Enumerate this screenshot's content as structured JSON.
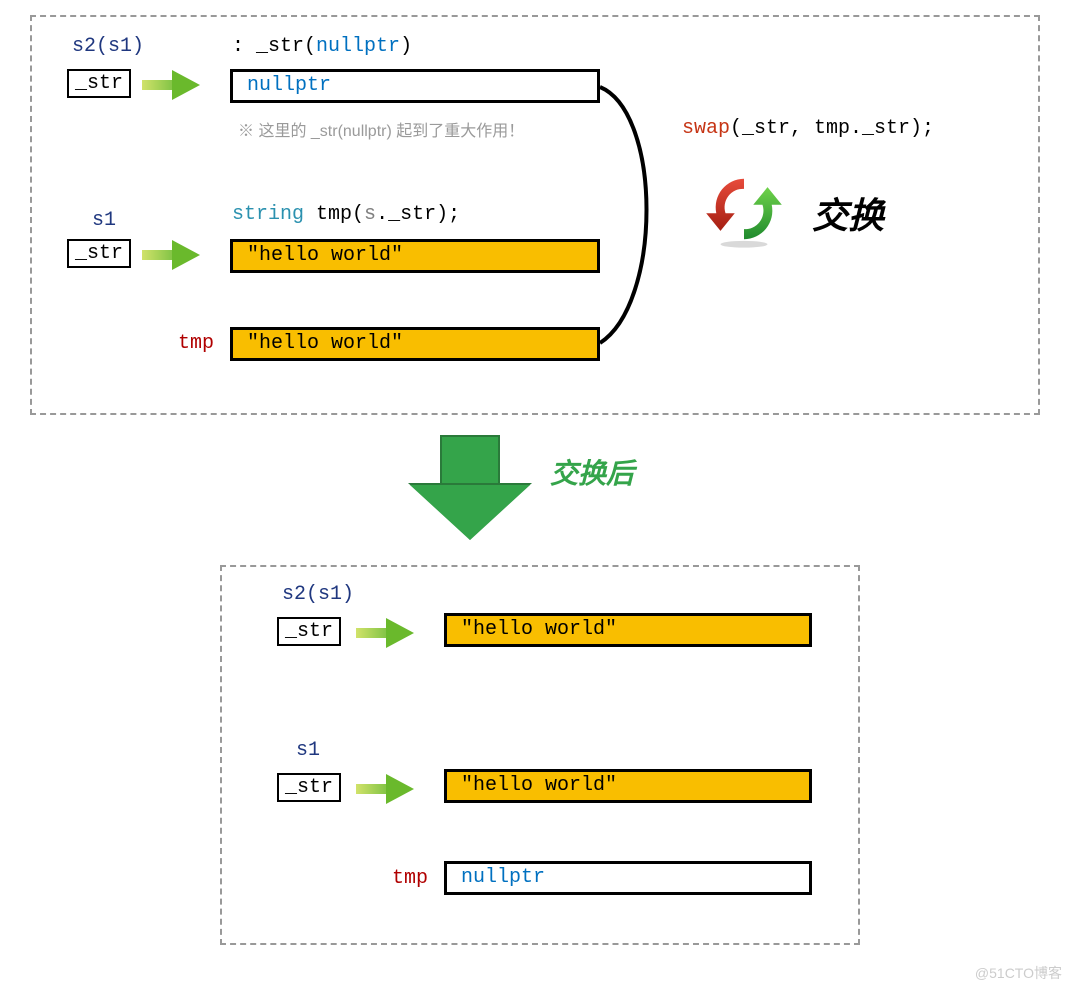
{
  "str_member": "_str",
  "labels": {
    "s2_s1": "s2(s1)",
    "s1": "s1",
    "tmp": "tmp"
  },
  "code": {
    "init_list_prefix": ": ",
    "init_list_mem": "_str",
    "init_list_arg": "nullptr",
    "tmp_type": "string",
    "tmp_name": " tmp",
    "tmp_arg_open": "(",
    "tmp_arg_obj": "s",
    "tmp_arg_dot": ".",
    "tmp_arg_mem": "_str",
    "tmp_arg_close": ");",
    "swap_func": "swap",
    "swap_args": "(_str, tmp._str);"
  },
  "note": "※ 这里的 _str(nullptr) 起到了重大作用！",
  "values": {
    "nullptr": "nullptr",
    "hello": "\"hello world\""
  },
  "swap_cn": "交换",
  "after_cn": "交换后",
  "watermark": "@51CTO博客"
}
